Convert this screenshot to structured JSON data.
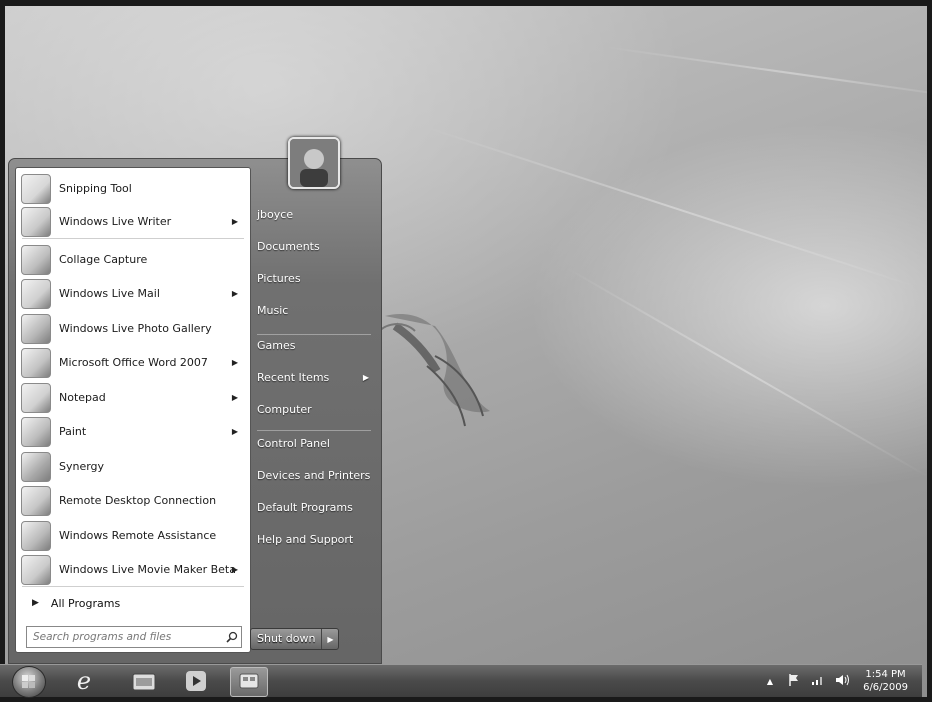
{
  "start_menu": {
    "programs": [
      {
        "label": "Snipping Tool",
        "icon": "snipping-tool-icon",
        "has_submenu": false
      },
      {
        "label": "Windows Live Writer",
        "icon": "live-writer-icon",
        "has_submenu": true
      },
      {
        "label": "Collage Capture",
        "icon": "collage-capture-icon",
        "has_submenu": false
      },
      {
        "label": "Windows Live Mail",
        "icon": "live-mail-icon",
        "has_submenu": true
      },
      {
        "label": "Windows Live Photo Gallery",
        "icon": "photo-gallery-icon",
        "has_submenu": false
      },
      {
        "label": "Microsoft Office Word 2007",
        "icon": "word-icon",
        "has_submenu": true
      },
      {
        "label": "Notepad",
        "icon": "notepad-icon",
        "has_submenu": true
      },
      {
        "label": "Paint",
        "icon": "paint-icon",
        "has_submenu": true
      },
      {
        "label": "Synergy",
        "icon": "synergy-icon",
        "has_submenu": false
      },
      {
        "label": "Remote Desktop Connection",
        "icon": "remote-desktop-icon",
        "has_submenu": false
      },
      {
        "label": "Windows Remote Assistance",
        "icon": "remote-assistance-icon",
        "has_submenu": false
      },
      {
        "label": "Windows Live Movie Maker Beta",
        "icon": "movie-maker-icon",
        "has_submenu": true
      }
    ],
    "all_programs_label": "All Programs",
    "search_placeholder": "Search programs and files",
    "right_items": [
      {
        "label": "jboyce",
        "has_submenu": false
      },
      {
        "label": "Documents",
        "has_submenu": false
      },
      {
        "label": "Pictures",
        "has_submenu": false
      },
      {
        "label": "Music",
        "has_submenu": false
      },
      {
        "label": "Games",
        "has_submenu": false
      },
      {
        "label": "Recent Items",
        "has_submenu": true
      },
      {
        "label": "Computer",
        "has_submenu": false
      },
      {
        "label": "Control Panel",
        "has_submenu": false
      },
      {
        "label": "Devices and Printers",
        "has_submenu": false
      },
      {
        "label": "Default Programs",
        "has_submenu": false
      },
      {
        "label": "Help and Support",
        "has_submenu": false
      }
    ],
    "shutdown_label": "Shut down"
  },
  "taskbar": {
    "pinned": [
      "internet-explorer-icon",
      "windows-explorer-icon",
      "media-player-icon",
      "active-app-icon"
    ],
    "clock_time": "1:54 PM",
    "clock_date": "6/6/2009"
  }
}
